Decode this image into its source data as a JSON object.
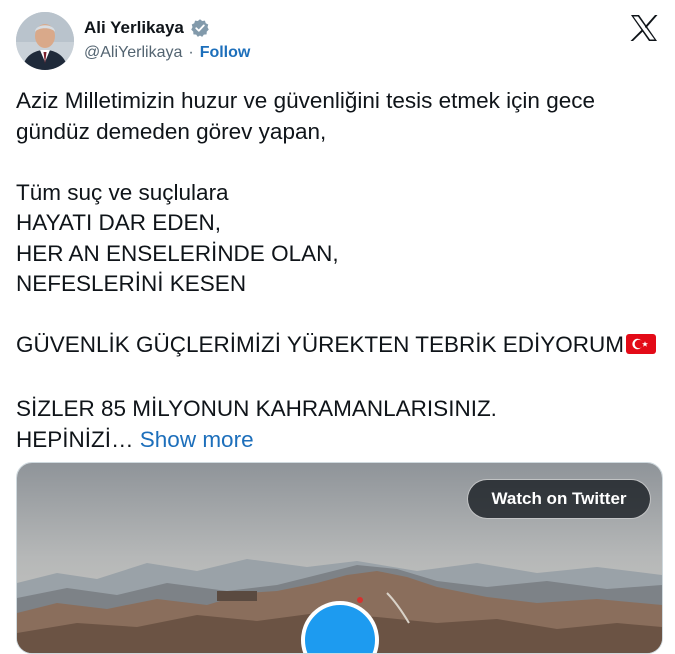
{
  "author": {
    "name": "Ali Yerlikaya",
    "handle": "@AliYerlikaya",
    "separator": "·",
    "follow_label": "Follow",
    "verified_icon": "verified-badge-icon"
  },
  "brand": {
    "logo": "x-logo-icon"
  },
  "tweet": {
    "lines": [
      "Aziz Milletimizin huzur ve güvenliğini tesis etmek için gece",
      "gündüz demeden görev yapan,",
      "",
      "Tüm suç ve suçlulara",
      "HAYATI DAR EDEN,",
      "HER AN ENSELERİNDE OLAN,",
      "NEFESLERİNİ KESEN",
      "",
      "GÜVENLİK GÜÇLERİMİZİ YÜREKTEN TEBRİK EDİYORUM",
      "",
      "SİZLER 85 MİLYONUN KAHRAMANLARISINIZ.",
      "HEPİNİZİ…"
    ],
    "show_more_label": "Show more",
    "flag_icon": "turkey-flag-icon"
  },
  "media": {
    "watch_label": "Watch on Twitter",
    "play_icon": "play-icon"
  },
  "colors": {
    "link": "#1d6fbb",
    "verified": "#829aab",
    "play_button": "#1d9bf0",
    "text": "#0f1419",
    "secondary_text": "#536471"
  }
}
